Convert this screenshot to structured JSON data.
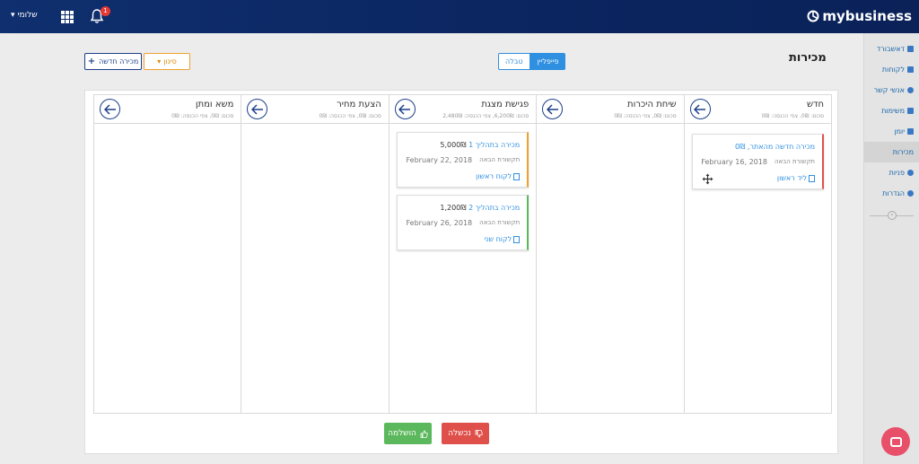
{
  "topbar": {
    "user_label": "שלומי",
    "notification_count": "1",
    "brand": "mybusiness"
  },
  "sidebar": {
    "items": [
      {
        "label": "דאשבורד"
      },
      {
        "label": "לקוחות"
      },
      {
        "label": "אנשי קשר"
      },
      {
        "label": "משימות"
      },
      {
        "label": "יומן"
      },
      {
        "label": "מכירות"
      },
      {
        "label": "פניות"
      },
      {
        "label": "הגדרות"
      }
    ]
  },
  "header": {
    "title": "מכירות",
    "view_pipeline": "פייפליין",
    "view_table": "טבלה",
    "new_sale": "מכירה חדשה",
    "filter": "סינון"
  },
  "board": {
    "columns": [
      {
        "title": "חדש",
        "summary": "סכום: 0₪, צפי הכנסה: 0₪",
        "cards": [
          {
            "title": "מכירה חדשה מהאתר, 0₪",
            "amount": "",
            "next_label": "תקשורת הבאה",
            "date": "February 16, 2018",
            "contact": "ליד ראשון",
            "accent": "#e0504a"
          }
        ]
      },
      {
        "title": "שיחת היכרות",
        "summary": "סכום: 0₪, צפי הכנסה: 0₪",
        "cards": []
      },
      {
        "title": "פגישת מצגת",
        "summary": "סכום: 6,200₪, צפי הכנסה: 2,480₪",
        "cards": [
          {
            "title": "מכירה בתהליך 1",
            "amount": "5,000₪",
            "next_label": "תקשורת הבאה",
            "date": "February 22, 2018",
            "contact": "לקוח ראשון",
            "accent": "#f0a030"
          },
          {
            "title": "מכירה בתהליך 2",
            "amount": "1,200₪",
            "next_label": "תקשורת הבאה",
            "date": "February 26, 2018",
            "contact": "לקוח שני",
            "accent": "#5cb85c"
          }
        ]
      },
      {
        "title": "הצעת מחיר",
        "summary": "סכום: 0₪, צפי הכנסה: 0₪",
        "cards": []
      },
      {
        "title": "משא ומתן",
        "summary": "סכום: 0₪, צפי הכנסה: 0₪",
        "cards": []
      }
    ]
  },
  "actions": {
    "won": "הושלמה",
    "lost": "נכשלה"
  }
}
